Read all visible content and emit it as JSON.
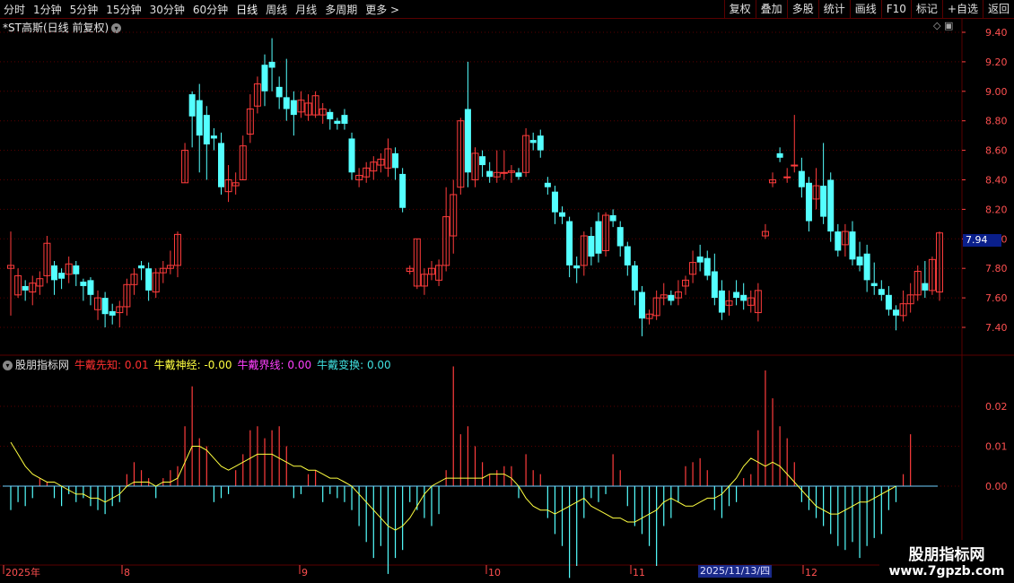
{
  "toolbar": {
    "periods": [
      "分时",
      "1分钟",
      "5分钟",
      "15分钟",
      "30分钟",
      "60分钟",
      "日线",
      "周线",
      "月线",
      "多周期",
      "更多 >"
    ],
    "active_period": "日线",
    "tools": [
      "复权",
      "叠加",
      "多股",
      "统计",
      "画线",
      "F10",
      "标记",
      "+自选",
      "返回"
    ]
  },
  "stock": {
    "title": "*ST高斯(日线 前复权)",
    "dropdown_icon": "chevron-down-icon"
  },
  "price_axis": {
    "ticks": [
      "9.40",
      "9.20",
      "9.00",
      "8.80",
      "8.60",
      "8.40",
      "8.20",
      "8.00",
      "7.80",
      "7.60",
      "7.40"
    ],
    "current_price": "7.94"
  },
  "indicator": {
    "name": "股朋指标网",
    "lines": [
      {
        "label": "牛戴先知: 0.01",
        "color": "#ff3030"
      },
      {
        "label": "牛戴神经: -0.00",
        "color": "#ffff40"
      },
      {
        "label": "牛戴界线: 0.00",
        "color": "#ff40ff"
      },
      {
        "label": "牛戴变换: 0.00",
        "color": "#40e0e0"
      }
    ],
    "axis_ticks": [
      "0.02",
      "0.01",
      "0.00"
    ]
  },
  "x_axis": {
    "labels": [
      "2025年",
      "8",
      "9",
      "10",
      "11",
      "12"
    ],
    "cursor_date": "2025/11/13/四"
  },
  "watermark": {
    "line1": "股朋指标网",
    "line2": "www.7gpzb.com"
  },
  "colors": {
    "up": "#ff3c3c",
    "down": "#54ffff",
    "grid": "#5a0000",
    "ma": "#ffff40"
  },
  "chart_data": {
    "type": "candlestick",
    "price_range": [
      7.3,
      9.45
    ],
    "candles": [
      [
        7.8,
        7.82,
        7.48,
        8.05
      ],
      [
        7.62,
        7.75,
        7.6,
        7.8
      ],
      [
        7.68,
        7.65,
        7.58,
        7.72
      ],
      [
        7.64,
        7.7,
        7.55,
        7.75
      ],
      [
        7.68,
        7.73,
        7.62,
        7.78
      ],
      [
        7.75,
        7.97,
        7.7,
        8.02
      ],
      [
        7.82,
        7.72,
        7.62,
        7.85
      ],
      [
        7.77,
        7.73,
        7.66,
        7.8
      ],
      [
        7.76,
        7.83,
        7.7,
        7.88
      ],
      [
        7.82,
        7.76,
        7.68,
        7.85
      ],
      [
        7.71,
        7.68,
        7.58,
        7.73
      ],
      [
        7.72,
        7.62,
        7.55,
        7.74
      ],
      [
        7.52,
        7.6,
        7.45,
        7.65
      ],
      [
        7.6,
        7.49,
        7.4,
        7.64
      ],
      [
        7.51,
        7.48,
        7.42,
        7.56
      ],
      [
        7.5,
        7.54,
        7.4,
        7.58
      ],
      [
        7.54,
        7.69,
        7.48,
        7.73
      ],
      [
        7.69,
        7.76,
        7.62,
        7.8
      ],
      [
        7.82,
        7.8,
        7.72,
        7.85
      ],
      [
        7.8,
        7.65,
        7.58,
        7.84
      ],
      [
        7.64,
        7.77,
        7.6,
        7.8
      ],
      [
        7.77,
        7.8,
        7.7,
        7.85
      ],
      [
        7.8,
        7.82,
        7.76,
        7.92
      ],
      [
        7.82,
        8.03,
        7.74,
        8.05
      ],
      [
        8.38,
        8.6,
        8.38,
        8.65
      ],
      [
        8.98,
        8.83,
        8.62,
        9.0
      ],
      [
        8.94,
        8.7,
        8.45,
        9.05
      ],
      [
        8.84,
        8.64,
        8.4,
        8.9
      ],
      [
        8.7,
        8.68,
        8.6,
        8.75
      ],
      [
        8.65,
        8.35,
        8.3,
        8.72
      ],
      [
        8.32,
        8.4,
        8.25,
        8.5
      ],
      [
        8.36,
        8.38,
        8.3,
        8.45
      ],
      [
        8.4,
        8.63,
        8.4,
        8.7
      ],
      [
        8.71,
        8.88,
        8.65,
        8.98
      ],
      [
        8.9,
        9.05,
        8.85,
        9.1
      ],
      [
        9.18,
        9.0,
        8.9,
        9.25
      ],
      [
        9.2,
        9.16,
        9.0,
        9.36
      ],
      [
        9.03,
        8.96,
        8.88,
        9.1
      ],
      [
        8.96,
        8.88,
        8.8,
        9.22
      ],
      [
        8.94,
        8.84,
        8.7,
        9.0
      ],
      [
        8.86,
        8.94,
        8.82,
        9.0
      ],
      [
        8.84,
        8.92,
        8.8,
        8.98
      ],
      [
        8.84,
        8.97,
        8.82,
        9.0
      ],
      [
        8.84,
        8.88,
        8.78,
        8.92
      ],
      [
        8.86,
        8.81,
        8.74,
        8.88
      ],
      [
        8.8,
        8.78,
        8.74,
        8.82
      ],
      [
        8.84,
        8.78,
        8.74,
        8.88
      ],
      [
        8.68,
        8.45,
        8.4,
        8.72
      ],
      [
        8.4,
        8.43,
        8.35,
        8.48
      ],
      [
        8.42,
        8.48,
        8.38,
        8.52
      ],
      [
        8.46,
        8.52,
        8.4,
        8.56
      ],
      [
        8.5,
        8.54,
        8.45,
        8.58
      ],
      [
        8.48,
        8.61,
        8.42,
        8.68
      ],
      [
        8.58,
        8.48,
        8.4,
        8.62
      ],
      [
        8.44,
        8.21,
        8.18,
        8.48
      ],
      [
        7.78,
        7.8,
        7.76,
        7.82
      ],
      [
        7.68,
        8.0,
        7.66,
        8.0
      ],
      [
        7.68,
        7.76,
        7.62,
        7.8
      ],
      [
        7.76,
        7.8,
        7.72,
        7.85
      ],
      [
        7.72,
        7.82,
        7.68,
        7.86
      ],
      [
        7.82,
        8.15,
        7.78,
        8.35
      ],
      [
        8.02,
        8.3,
        7.9,
        8.4
      ],
      [
        8.35,
        8.8,
        8.3,
        8.82
      ],
      [
        8.88,
        8.45,
        8.35,
        9.2
      ],
      [
        8.4,
        8.58,
        8.35,
        8.62
      ],
      [
        8.56,
        8.5,
        8.42,
        8.6
      ],
      [
        8.46,
        8.42,
        8.38,
        8.52
      ],
      [
        8.42,
        8.45,
        8.38,
        8.6
      ],
      [
        8.45,
        8.45,
        8.4,
        8.6
      ],
      [
        8.45,
        8.46,
        8.38,
        8.5
      ],
      [
        8.45,
        8.42,
        8.4,
        8.48
      ],
      [
        8.45,
        8.7,
        8.42,
        8.75
      ],
      [
        8.67,
        8.65,
        8.6,
        8.72
      ],
      [
        8.7,
        8.6,
        8.55,
        8.74
      ],
      [
        8.38,
        8.35,
        8.3,
        8.42
      ],
      [
        8.32,
        8.18,
        8.1,
        8.36
      ],
      [
        8.18,
        8.15,
        8.1,
        8.22
      ],
      [
        8.12,
        7.82,
        7.74,
        8.15
      ],
      [
        7.82,
        7.8,
        7.7,
        7.88
      ],
      [
        7.82,
        8.02,
        7.75,
        8.05
      ],
      [
        8.02,
        7.88,
        7.82,
        8.08
      ],
      [
        8.12,
        7.9,
        7.84,
        8.18
      ],
      [
        7.92,
        8.16,
        7.88,
        8.18
      ],
      [
        8.16,
        8.12,
        8.08,
        8.2
      ],
      [
        8.08,
        7.95,
        7.88,
        8.12
      ],
      [
        7.95,
        7.82,
        7.75,
        7.98
      ],
      [
        7.82,
        7.65,
        7.55,
        7.85
      ],
      [
        7.64,
        7.46,
        7.34,
        7.68
      ],
      [
        7.46,
        7.49,
        7.42,
        7.52
      ],
      [
        7.48,
        7.6,
        7.45,
        7.65
      ],
      [
        7.6,
        7.62,
        7.55,
        7.7
      ],
      [
        7.62,
        7.58,
        7.55,
        7.65
      ],
      [
        7.6,
        7.64,
        7.55,
        7.72
      ],
      [
        7.68,
        7.72,
        7.62,
        7.75
      ],
      [
        7.76,
        7.84,
        7.7,
        7.92
      ],
      [
        7.88,
        7.84,
        7.78,
        7.96
      ],
      [
        7.87,
        7.75,
        7.72,
        7.92
      ],
      [
        7.78,
        7.6,
        7.55,
        7.9
      ],
      [
        7.65,
        7.5,
        7.45,
        7.72
      ],
      [
        7.55,
        7.58,
        7.48,
        7.65
      ],
      [
        7.64,
        7.6,
        7.55,
        7.72
      ],
      [
        7.62,
        7.58,
        7.52,
        7.7
      ],
      [
        7.55,
        7.6,
        7.5,
        7.65
      ],
      [
        7.5,
        7.65,
        7.44,
        7.7
      ],
      [
        8.02,
        8.05,
        8.0,
        8.1
      ],
      [
        8.38,
        8.4,
        8.35,
        8.45
      ],
      [
        8.58,
        8.55,
        8.52,
        8.62
      ],
      [
        8.42,
        8.42,
        8.38,
        8.48
      ],
      [
        8.5,
        8.5,
        8.45,
        8.84
      ],
      [
        8.46,
        8.35,
        8.28,
        8.55
      ],
      [
        8.38,
        8.12,
        8.05,
        8.42
      ],
      [
        8.27,
        8.36,
        8.2,
        8.48
      ],
      [
        8.36,
        8.15,
        8.1,
        8.65
      ],
      [
        8.4,
        8.05,
        7.98,
        8.45
      ],
      [
        8.05,
        7.92,
        7.88,
        8.1
      ],
      [
        7.96,
        8.05,
        7.88,
        8.1
      ],
      [
        8.05,
        7.86,
        7.82,
        8.12
      ],
      [
        7.88,
        7.82,
        7.78,
        7.98
      ],
      [
        7.9,
        7.72,
        7.64,
        7.96
      ],
      [
        7.7,
        7.68,
        7.62,
        7.84
      ],
      [
        7.66,
        7.62,
        7.58,
        7.72
      ],
      [
        7.62,
        7.52,
        7.48,
        7.68
      ],
      [
        7.52,
        7.48,
        7.38,
        7.55
      ],
      [
        7.48,
        7.56,
        7.44,
        7.65
      ],
      [
        7.56,
        7.62,
        7.5,
        7.7
      ],
      [
        7.62,
        7.78,
        7.58,
        7.82
      ],
      [
        7.7,
        7.65,
        7.6,
        7.85
      ],
      [
        7.65,
        7.86,
        7.62,
        7.88
      ],
      [
        7.64,
        8.04,
        7.58,
        8.05
      ]
    ],
    "indicator_bars": [
      -0.006,
      -0.004,
      -0.005,
      -0.003,
      0.002,
      0.001,
      -0.003,
      -0.005,
      -0.002,
      -0.004,
      -0.003,
      -0.005,
      -0.006,
      -0.007,
      -0.005,
      -0.004,
      0.003,
      0.006,
      0.004,
      0.002,
      -0.003,
      0.002,
      0.004,
      0.005,
      0.015,
      0.025,
      0.012,
      0.01,
      -0.004,
      -0.003,
      -0.002,
      0.004,
      0.008,
      0.014,
      0.015,
      0.012,
      0.014,
      0.015,
      0.01,
      -0.003,
      -0.002,
      0.003,
      0.004,
      -0.004,
      -0.002,
      -0.003,
      -0.004,
      -0.006,
      -0.01,
      -0.014,
      -0.018,
      -0.015,
      -0.022,
      -0.018,
      -0.016,
      -0.004,
      -0.006,
      -0.008,
      -0.01,
      -0.007,
      0.004,
      0.03,
      0.013,
      0.015,
      0.01,
      0.006,
      0.003,
      0.004,
      0.005,
      0.005,
      -0.003,
      0.008,
      0.004,
      0.003,
      -0.008,
      -0.012,
      -0.015,
      -0.023,
      -0.02,
      -0.008,
      -0.003,
      -0.004,
      -0.002,
      0.008,
      0.004,
      -0.005,
      -0.01,
      -0.012,
      -0.015,
      -0.02,
      -0.01,
      -0.008,
      -0.004,
      0.005,
      0.006,
      0.007,
      0.004,
      -0.006,
      -0.008,
      -0.005,
      -0.004,
      0.002,
      0.003,
      0.014,
      0.029,
      0.022,
      0.015,
      0.012,
      0.006,
      -0.004,
      -0.006,
      -0.008,
      -0.01,
      -0.012,
      -0.015,
      -0.016,
      -0.014,
      -0.018,
      -0.015,
      -0.013,
      -0.012,
      -0.006,
      -0.004,
      0.003,
      0.013
    ],
    "indicator_line": [
      0.011,
      0.008,
      0.005,
      0.003,
      0.002,
      0.001,
      0.001,
      0.0,
      -0.001,
      -0.002,
      -0.002,
      -0.003,
      -0.003,
      -0.004,
      -0.003,
      -0.002,
      0.0,
      0.001,
      0.001,
      0.001,
      0.0,
      0.001,
      0.001,
      0.002,
      0.006,
      0.01,
      0.01,
      0.009,
      0.007,
      0.005,
      0.004,
      0.005,
      0.006,
      0.007,
      0.008,
      0.008,
      0.008,
      0.007,
      0.006,
      0.005,
      0.005,
      0.004,
      0.004,
      0.003,
      0.002,
      0.002,
      0.001,
      0.0,
      -0.002,
      -0.004,
      -0.006,
      -0.008,
      -0.01,
      -0.011,
      -0.01,
      -0.008,
      -0.005,
      -0.002,
      0.0,
      0.001,
      0.002,
      0.002,
      0.002,
      0.002,
      0.002,
      0.002,
      0.003,
      0.003,
      0.003,
      0.002,
      0.0,
      -0.003,
      -0.005,
      -0.006,
      -0.006,
      -0.007,
      -0.006,
      -0.005,
      -0.004,
      -0.003,
      -0.005,
      -0.006,
      -0.007,
      -0.008,
      -0.008,
      -0.009,
      -0.009,
      -0.008,
      -0.007,
      -0.006,
      -0.004,
      -0.003,
      -0.004,
      -0.005,
      -0.005,
      -0.004,
      -0.003,
      -0.003,
      -0.002,
      0.0,
      0.002,
      0.005,
      0.007,
      0.006,
      0.005,
      0.006,
      0.005,
      0.003,
      0.001,
      -0.001,
      -0.003,
      -0.005,
      -0.006,
      -0.007,
      -0.007,
      -0.006,
      -0.005,
      -0.004,
      -0.004,
      -0.003,
      -0.002,
      -0.001,
      0.0
    ]
  }
}
